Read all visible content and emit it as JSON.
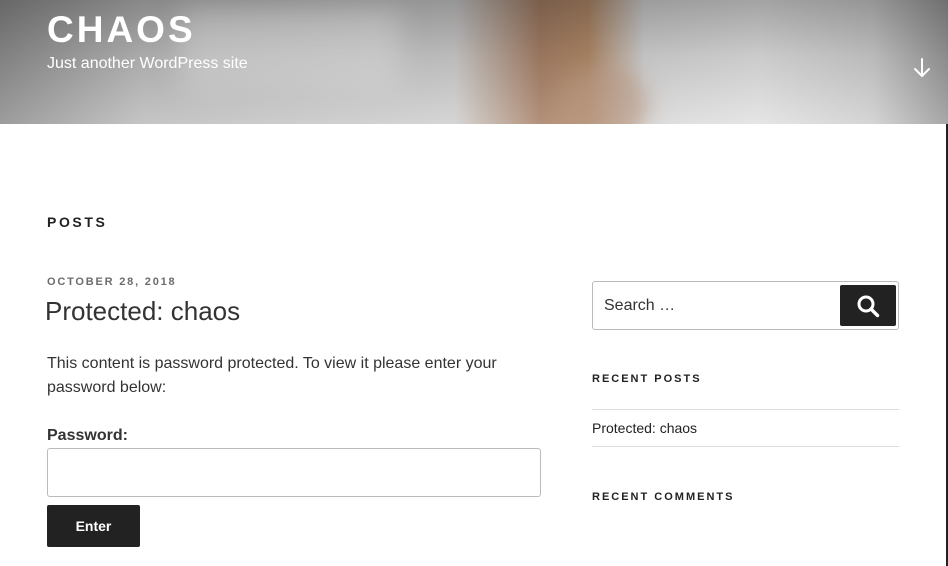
{
  "header": {
    "site_title": "CHAOS",
    "site_description": "Just another WordPress site",
    "scroll_icon": "arrow-down-icon"
  },
  "main": {
    "page_title": "POSTS",
    "post": {
      "date": "OCTOBER 28, 2018",
      "title": "Protected: chaos",
      "content": "This content is password protected. To view it please enter your password below:",
      "password_label": "Password:",
      "password_value": "",
      "submit_label": "Enter"
    }
  },
  "sidebar": {
    "search": {
      "placeholder": "Search …",
      "value": "",
      "button_icon": "search-icon"
    },
    "recent_posts": {
      "title": "RECENT POSTS",
      "items": [
        {
          "label": "Protected: chaos"
        }
      ]
    },
    "recent_comments": {
      "title": "RECENT COMMENTS"
    }
  },
  "colors": {
    "text": "#222222",
    "button_bg": "#222222",
    "button_text": "#ffffff",
    "date_text": "#6c6c6c",
    "border": "#bbbbbb"
  }
}
